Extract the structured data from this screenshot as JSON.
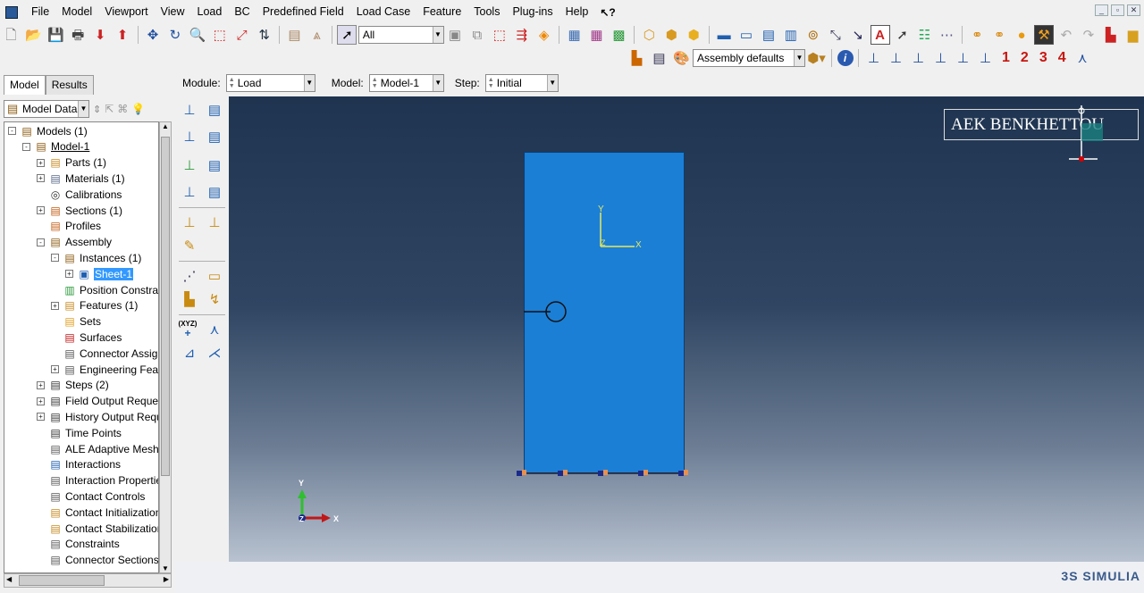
{
  "menubar": {
    "items": [
      "File",
      "Model",
      "Viewport",
      "View",
      "Load",
      "BC",
      "Predefined Field",
      "Load Case",
      "Feature",
      "Tools",
      "Plug-ins",
      "Help"
    ],
    "whats_this": "↖?"
  },
  "toolbar": {
    "selection_filter": "All",
    "render_style": "Assembly defaults",
    "numbers": [
      "1",
      "2",
      "3",
      "4"
    ]
  },
  "tabs": [
    "Model",
    "Results"
  ],
  "tree_combo": "Model Datab",
  "tree": [
    {
      "label": "Models (1)",
      "level": 0,
      "exp": "-"
    },
    {
      "label": "Model-1",
      "level": 1,
      "exp": "-",
      "style": "ul"
    },
    {
      "label": "Parts (1)",
      "level": 2,
      "exp": "+"
    },
    {
      "label": "Materials (1)",
      "level": 2,
      "exp": "+"
    },
    {
      "label": "Calibrations",
      "level": 2,
      "exp": ""
    },
    {
      "label": "Sections (1)",
      "level": 2,
      "exp": "+"
    },
    {
      "label": "Profiles",
      "level": 2,
      "exp": ""
    },
    {
      "label": "Assembly",
      "level": 2,
      "exp": "-"
    },
    {
      "label": "Instances (1)",
      "level": 3,
      "exp": "-"
    },
    {
      "label": "Sheet-1",
      "level": 4,
      "exp": "+",
      "style": "sel"
    },
    {
      "label": "Position Constrair",
      "level": 3,
      "exp": ""
    },
    {
      "label": "Features (1)",
      "level": 3,
      "exp": "+"
    },
    {
      "label": "Sets",
      "level": 3,
      "exp": ""
    },
    {
      "label": "Surfaces",
      "level": 3,
      "exp": ""
    },
    {
      "label": "Connector Assign",
      "level": 3,
      "exp": ""
    },
    {
      "label": "Engineering Featu",
      "level": 3,
      "exp": "+"
    },
    {
      "label": "Steps (2)",
      "level": 2,
      "exp": "+"
    },
    {
      "label": "Field Output Request",
      "level": 2,
      "exp": "+"
    },
    {
      "label": "History Output Reque",
      "level": 2,
      "exp": "+"
    },
    {
      "label": "Time Points",
      "level": 2,
      "exp": ""
    },
    {
      "label": "ALE Adaptive Mesh C",
      "level": 2,
      "exp": ""
    },
    {
      "label": "Interactions",
      "level": 2,
      "exp": ""
    },
    {
      "label": "Interaction Properties",
      "level": 2,
      "exp": ""
    },
    {
      "label": "Contact Controls",
      "level": 2,
      "exp": ""
    },
    {
      "label": "Contact Initializations",
      "level": 2,
      "exp": ""
    },
    {
      "label": "Contact Stabilizations",
      "level": 2,
      "exp": ""
    },
    {
      "label": "Constraints",
      "level": 2,
      "exp": ""
    },
    {
      "label": "Connector Sections",
      "level": 2,
      "exp": ""
    }
  ],
  "context": {
    "module_label": "Module:",
    "module_value": "Load",
    "model_label": "Model:",
    "model_value": "Model-1",
    "step_label": "Step:",
    "step_value": "Initial"
  },
  "viewport": {
    "watermark": "AEK BENKHETTOU",
    "part_axis_y": "Y",
    "part_axis_x": "X",
    "part_axis_z": "Z",
    "global_axis_y": "Y",
    "global_axis_x": "X",
    "global_axis_z": "Z",
    "part_color": "#1b7fd6"
  },
  "brand": "3S SIMULIA"
}
